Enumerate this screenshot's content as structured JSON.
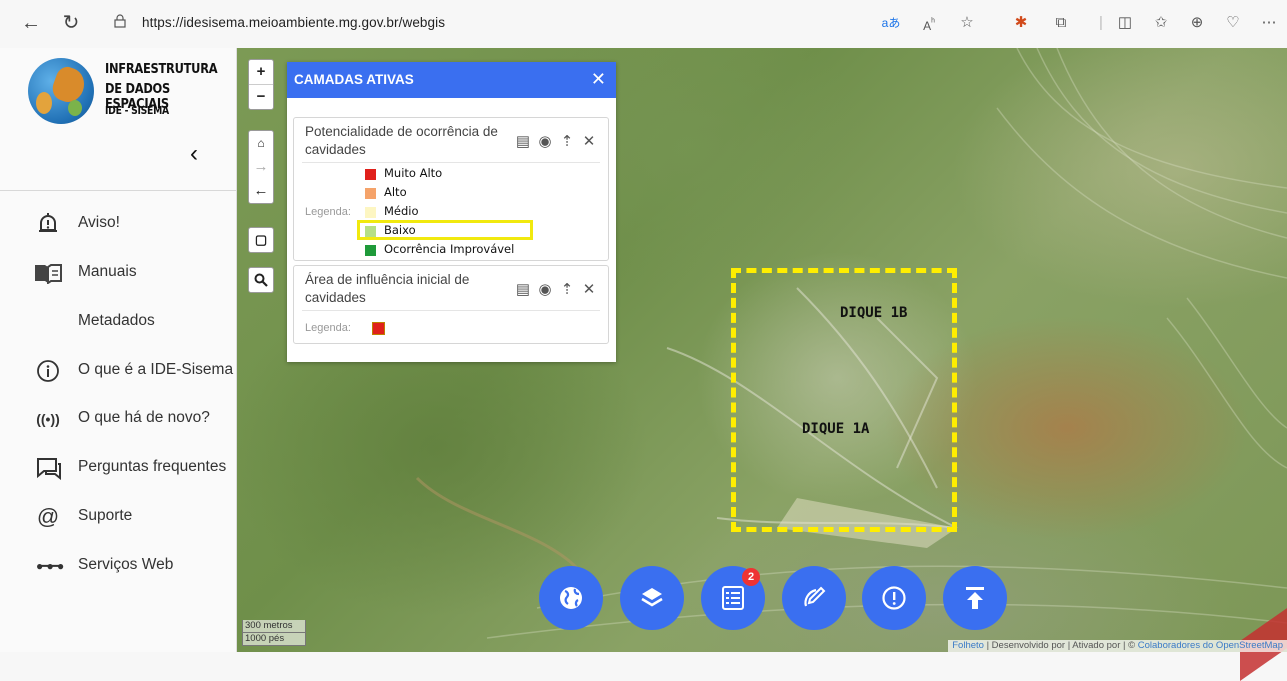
{
  "browser": {
    "url": "https://idesisema.meioambiente.mg.gov.br/webgis",
    "icons": [
      "back-icon",
      "refresh-icon",
      "lock-icon",
      "translate-icon",
      "read-aloud-icon",
      "favorite-icon",
      "extension-icon",
      "extensions-icon",
      "split-screen-icon",
      "favorites-bar-icon",
      "collections-icon",
      "copilot-icon",
      "more-icon"
    ]
  },
  "sidebar": {
    "brand_line1": "INFRAESTRUTURA",
    "brand_line2": "DE DADOS ESPACIAIS",
    "brand_line3": "IDE - SISEMA",
    "collapse_glyph": "‹",
    "items": [
      {
        "icon": "alert-icon",
        "label": "Aviso!"
      },
      {
        "icon": "book-icon",
        "label": "Manuais"
      },
      {
        "icon": "",
        "label": "Metadados"
      },
      {
        "icon": "info-icon",
        "label": "O que é a IDE-Sisema"
      },
      {
        "icon": "broadcast-icon",
        "label": "O que há de novo?"
      },
      {
        "icon": "chat-icon",
        "label": "Perguntas frequentes"
      },
      {
        "icon": "at-icon",
        "label": "Suporte"
      },
      {
        "icon": "dots-icon",
        "label": "Serviços Web"
      }
    ]
  },
  "panel": {
    "title": "CAMADAS ATIVAS",
    "layers": [
      {
        "title": "Potencialidade de ocorrência de cavidades",
        "legend_label": "Legenda:",
        "legend": [
          {
            "label": "Muito Alto",
            "color": "#e0201b"
          },
          {
            "label": "Alto",
            "color": "#f5a36a"
          },
          {
            "label": "Médio",
            "color": "#fdf6c2"
          },
          {
            "label": "Baixo",
            "color": "#b6df85"
          },
          {
            "label": "Ocorrência Improvável",
            "color": "#1f9a3a"
          }
        ]
      },
      {
        "title": "Área de influência inicial de cavidades",
        "legend_label": "Legenda:",
        "legend_color": "#e0201b"
      }
    ]
  },
  "annotations": {
    "label_1b": "DIQUE 1B",
    "label_1a": "DIQUE 1A",
    "highlight_color": "#ffee00"
  },
  "fabs": {
    "badge_count": "2"
  },
  "scale": {
    "metric": "300 metros",
    "imperial": "1000 pés"
  },
  "attribution": {
    "text1": "Folheto",
    "text2": " | Desenvolvido por | Ativado por | © ",
    "link": "Colaboradores do OpenStreetMap"
  },
  "colors": {
    "accent": "#3a6ff0"
  }
}
